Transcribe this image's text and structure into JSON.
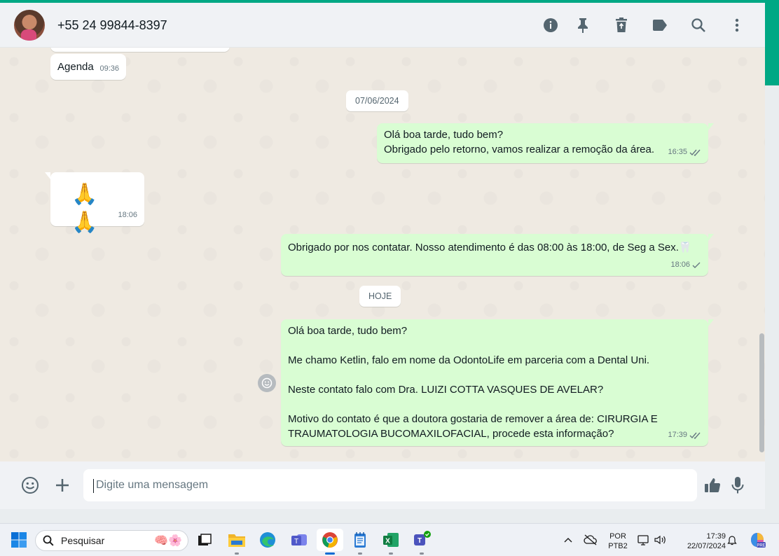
{
  "header": {
    "contact_name": "+55 24 99844-8397",
    "icons": [
      "info-icon",
      "pin-icon",
      "delete-icon",
      "label-icon",
      "search-icon",
      "menu-icon"
    ]
  },
  "messages": [
    {
      "direction": "in",
      "text": "Agenda",
      "time": "09:36"
    },
    {
      "type": "date",
      "text": "07/06/2024"
    },
    {
      "direction": "out",
      "text": "Olá boa tarde, tudo bem?\nObrigado pelo retorno, vamos realizar a remoção da área.",
      "time": "16:35",
      "status": "read"
    },
    {
      "direction": "in",
      "text": "🙏 🙏",
      "time": "18:06"
    },
    {
      "direction": "out",
      "text": "Obrigado por nos contatar. Nosso atendimento é das 08:00 às 18:00, de Seg a Sex.🦷",
      "time": "18:06",
      "status": "sent"
    },
    {
      "type": "date",
      "text": "HOJE"
    },
    {
      "direction": "out",
      "text": "Olá boa tarde, tudo bem?\n\nMe chamo Ketlin, falo em nome da OdontoLife em parceria com a Dental Uni.\n\nNeste contato falo com Dra. LUIZI COTTA VASQUES DE AVELAR?\n\nMotivo do contato é que a doutora gostaria de remover a área de: CIRURGIA E TRAUMATOLOGIA BUCOMAXILOFACIAL, procede esta informação?",
      "time": "17:39",
      "status": "read"
    }
  ],
  "composer": {
    "placeholder": "Digite uma mensagem"
  },
  "taskbar": {
    "search_label": "Pesquisar",
    "lang_primary": "POR",
    "lang_secondary": "PTB2",
    "clock_time": "17:39",
    "clock_date": "22/07/2024"
  },
  "colors": {
    "accent": "#00a884",
    "outgoing_bubble": "#d9fdd3",
    "incoming_bubble": "#ffffff",
    "read_tick": "#667781"
  }
}
